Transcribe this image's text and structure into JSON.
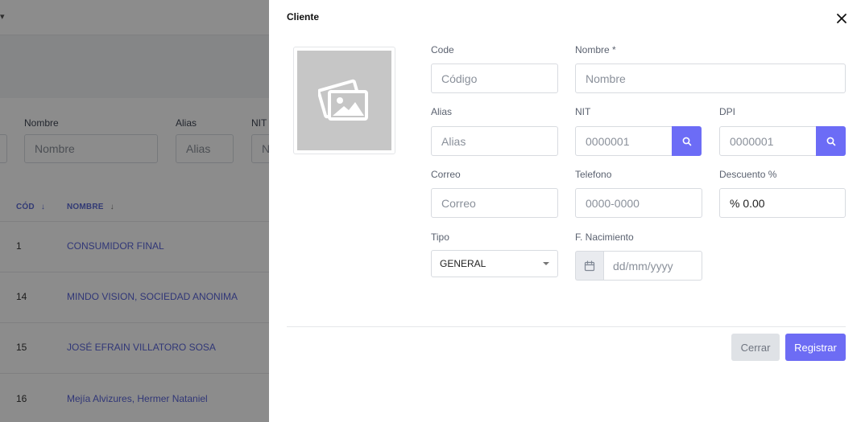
{
  "background": {
    "filters": {
      "nombre_label": "Nombre",
      "nombre_placeholder": "Nombre",
      "alias_label": "Alias",
      "alias_placeholder": "Alias",
      "nit_label": "NIT",
      "nit_placeholder": "N"
    },
    "table": {
      "headers": {
        "code": "CÓD",
        "name": "NOMBRE"
      },
      "rows": [
        {
          "code": "1",
          "name": "CONSUMIDOR FINAL"
        },
        {
          "code": "14",
          "name": "MINDO VISION, SOCIEDAD ANONIMA"
        },
        {
          "code": "15",
          "name": "JOSÉ EFRAIN VILLATORO SOSA"
        },
        {
          "code": "16",
          "name": "Mejía Alvizures, Hermer Nataniel"
        }
      ]
    }
  },
  "modal": {
    "title": "Cliente",
    "fields": {
      "code": {
        "label": "Code",
        "placeholder": "Código"
      },
      "nombre": {
        "label": "Nombre *",
        "placeholder": "Nombre"
      },
      "alias": {
        "label": "Alias",
        "placeholder": "Alias"
      },
      "nit": {
        "label": "NIT",
        "placeholder": "0000001"
      },
      "dpi": {
        "label": "DPI",
        "placeholder": "0000001"
      },
      "correo": {
        "label": "Correo",
        "placeholder": "Correo"
      },
      "telefono": {
        "label": "Telefono",
        "placeholder": "0000-0000"
      },
      "descuento": {
        "label": "Descuento %",
        "value": "% 0.00"
      },
      "tipo": {
        "label": "Tipo",
        "value": "GENERAL"
      },
      "nacimiento": {
        "label": "F. Nacimiento",
        "placeholder": "dd/mm/yyyy"
      }
    },
    "buttons": {
      "close": "Cerrar",
      "register": "Registrar"
    }
  },
  "colors": {
    "accent": "#6c6cf6",
    "link": "#5964d9",
    "overlay": "rgba(0,0,0,0.45)"
  }
}
